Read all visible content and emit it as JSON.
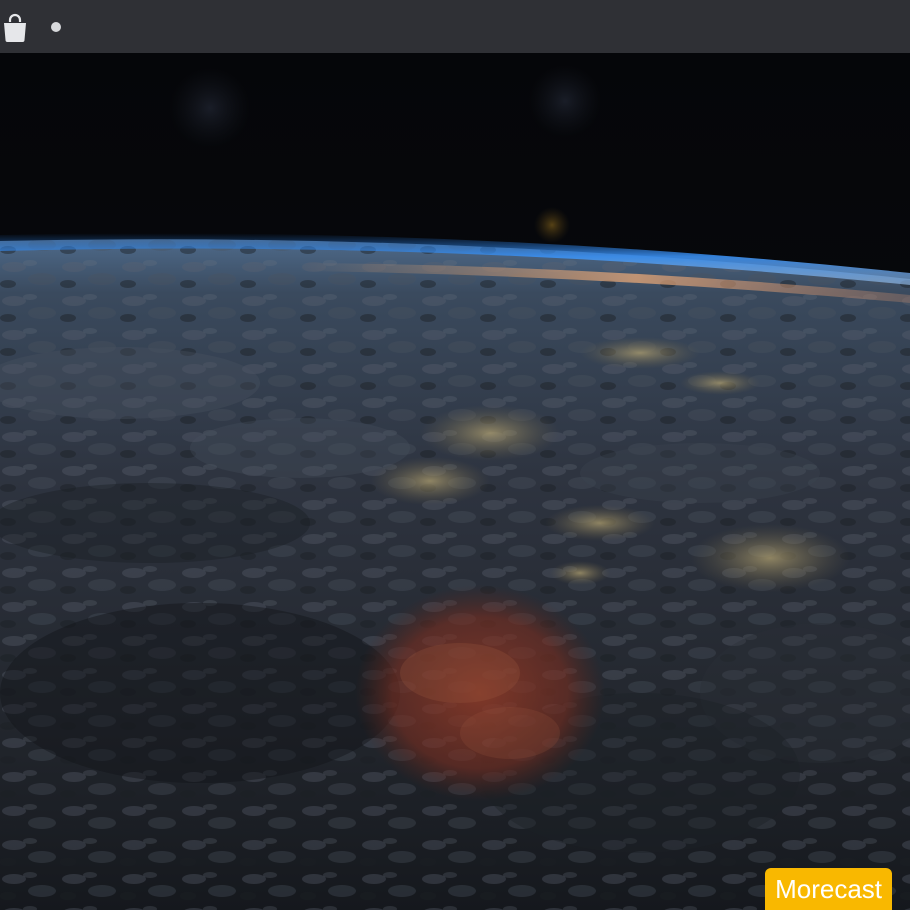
{
  "toolbar": {
    "icons": [
      "shopping-bag-icon",
      "dot-icon"
    ]
  },
  "photo": {
    "subject": "earth-from-orbit"
  },
  "badge": {
    "label": "Morecast",
    "color": "#f9b800"
  }
}
